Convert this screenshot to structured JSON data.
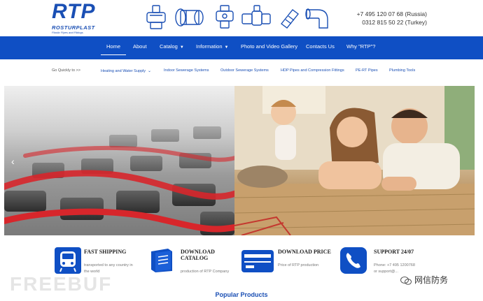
{
  "logo": {
    "mark": "RTP",
    "brand": "ROSTURPLAST",
    "tagline": "Plastic Pipes and Fittings"
  },
  "header": {
    "phone_russia": "+7 495 120 07 68 (Russia)",
    "phone_turkey": "0312 815 50 22 (Turkey)"
  },
  "nav": {
    "items": [
      {
        "label": "Home",
        "active": true
      },
      {
        "label": "About"
      },
      {
        "label": "Catalog",
        "dropdown": true
      },
      {
        "label": "Information",
        "dropdown": true
      },
      {
        "label": "Photo and Video Gallery"
      },
      {
        "label": "Contacts Us"
      },
      {
        "label": "Why \"RTP\"?"
      }
    ]
  },
  "quick": {
    "label": "Go Quickly to >>",
    "items": [
      "Heating and Water Supply",
      "Indoor Sewerage Systems",
      "Outdoor Sewerage Systems",
      "HDP Pipes and Compression Fittings",
      "PE-RT Pipes",
      "Plumbing Tools"
    ]
  },
  "features": [
    {
      "title": "FAST SHIPPING",
      "desc1": "transported to any country in",
      "desc2": "the world",
      "icon": "train-icon"
    },
    {
      "title": "DOWNLOAD",
      "title2": "CATALOG",
      "desc1": "production of RTP Company",
      "icon": "book-icon"
    },
    {
      "title": "DOWNLOAD PRICE",
      "desc1": "Price of RTP production",
      "icon": "card-icon"
    },
    {
      "title": "SUPPORT 24/07",
      "desc1": "Phone: +7 495 1200768",
      "desc2": "or support@...",
      "icon": "phone-icon"
    }
  ],
  "popular": "Popular Products",
  "watermark": {
    "left": "FREEBUF",
    "right": "网信防务"
  },
  "colors": {
    "brand": "#0f4fc4",
    "accent": "#e63a2e"
  }
}
